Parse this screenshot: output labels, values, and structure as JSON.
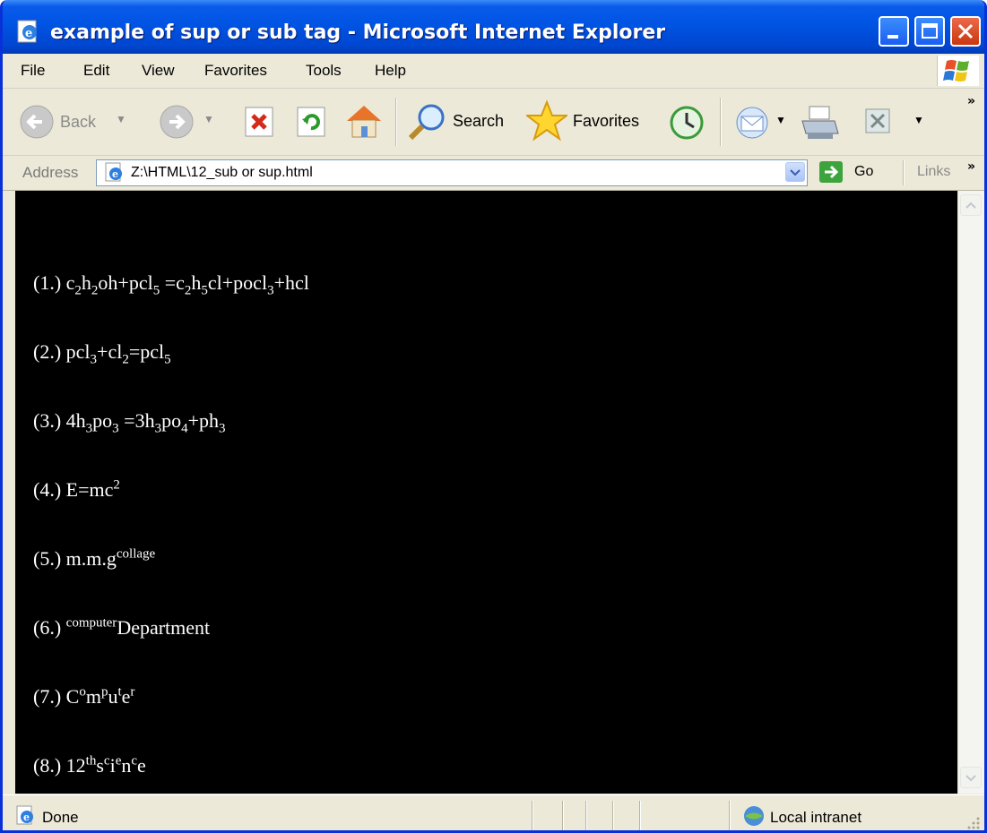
{
  "window": {
    "title": "example of sup or sub tag - Microsoft Internet Explorer"
  },
  "menu": [
    "File",
    "Edit",
    "View",
    "Favorites",
    "Tools",
    "Help"
  ],
  "toolbar": {
    "back_label": "Back",
    "search_label": "Search",
    "favorites_label": "Favorites",
    "overflow": "»"
  },
  "address_bar": {
    "label": "Address",
    "url": "Z:\\HTML\\12_sub or sup.html",
    "go_label": "Go",
    "links_label": "Links",
    "overflow": "»"
  },
  "content": {
    "background": "#000000",
    "text_color": "#ffffff",
    "lines": [
      {
        "num": "(1.)",
        "segments": [
          {
            "t": "c",
            "s": ""
          },
          {
            "t": "2",
            "s": "sub"
          },
          {
            "t": "h",
            "s": ""
          },
          {
            "t": "2",
            "s": "sub"
          },
          {
            "t": "oh+pcl",
            "s": ""
          },
          {
            "t": "5",
            "s": "sub"
          },
          {
            "t": " =c",
            "s": ""
          },
          {
            "t": "2",
            "s": "sub"
          },
          {
            "t": "h",
            "s": ""
          },
          {
            "t": "5",
            "s": "sub"
          },
          {
            "t": "cl+pocl",
            "s": ""
          },
          {
            "t": "3",
            "s": "sub"
          },
          {
            "t": "+hcl",
            "s": ""
          }
        ]
      },
      {
        "num": "(2.)",
        "segments": [
          {
            "t": "pcl",
            "s": ""
          },
          {
            "t": "3",
            "s": "sub"
          },
          {
            "t": "+cl",
            "s": ""
          },
          {
            "t": "2",
            "s": "sub"
          },
          {
            "t": "=pcl",
            "s": ""
          },
          {
            "t": "5",
            "s": "sub"
          }
        ]
      },
      {
        "num": "(3.)",
        "segments": [
          {
            "t": "4h",
            "s": ""
          },
          {
            "t": "3",
            "s": "sub"
          },
          {
            "t": "po",
            "s": ""
          },
          {
            "t": "3",
            "s": "sub"
          },
          {
            "t": " =3h",
            "s": ""
          },
          {
            "t": "3",
            "s": "sub"
          },
          {
            "t": "po",
            "s": ""
          },
          {
            "t": "4",
            "s": "sub"
          },
          {
            "t": "+ph",
            "s": ""
          },
          {
            "t": "3",
            "s": "sub"
          }
        ]
      },
      {
        "num": "(4.)",
        "segments": [
          {
            "t": "E=mc",
            "s": ""
          },
          {
            "t": "2",
            "s": "sup"
          }
        ]
      },
      {
        "num": "(5.)",
        "segments": [
          {
            "t": "m.m.g",
            "s": ""
          },
          {
            "t": "collage",
            "s": "sup"
          }
        ]
      },
      {
        "num": "(6.)",
        "segments": [
          {
            "t": "computer",
            "s": "sup"
          },
          {
            "t": "Department",
            "s": ""
          }
        ]
      },
      {
        "num": "(7.)",
        "segments": [
          {
            "t": "C",
            "s": ""
          },
          {
            "t": "o",
            "s": "sup"
          },
          {
            "t": "m",
            "s": ""
          },
          {
            "t": "p",
            "s": "sup"
          },
          {
            "t": "u",
            "s": ""
          },
          {
            "t": "t",
            "s": "sup"
          },
          {
            "t": "e",
            "s": ""
          },
          {
            "t": "r",
            "s": "sup"
          }
        ]
      },
      {
        "num": "(8.)",
        "segments": [
          {
            "t": "12",
            "s": ""
          },
          {
            "t": "th",
            "s": "sup"
          },
          {
            "t": "s",
            "s": ""
          },
          {
            "t": "c",
            "s": "sup"
          },
          {
            "t": "i",
            "s": ""
          },
          {
            "t": "e",
            "s": "sup"
          },
          {
            "t": "n",
            "s": ""
          },
          {
            "t": "c",
            "s": "sup"
          },
          {
            "t": "e",
            "s": ""
          }
        ]
      }
    ]
  },
  "status_bar": {
    "status": "Done",
    "zone": "Local intranet"
  },
  "colors": {
    "titlebar": "#0054e3",
    "chrome": "#ece9d8",
    "close_button": "#d9481e"
  },
  "icons": [
    "ie-page-icon",
    "minimize-icon",
    "maximize-icon",
    "close-icon",
    "windows-logo-icon",
    "back-arrow-icon",
    "forward-arrow-icon",
    "stop-icon",
    "refresh-icon",
    "home-icon",
    "search-icon",
    "favorites-star-icon",
    "history-icon",
    "mail-icon",
    "print-icon",
    "edit-icon",
    "go-arrow-icon",
    "intranet-zone-icon"
  ]
}
